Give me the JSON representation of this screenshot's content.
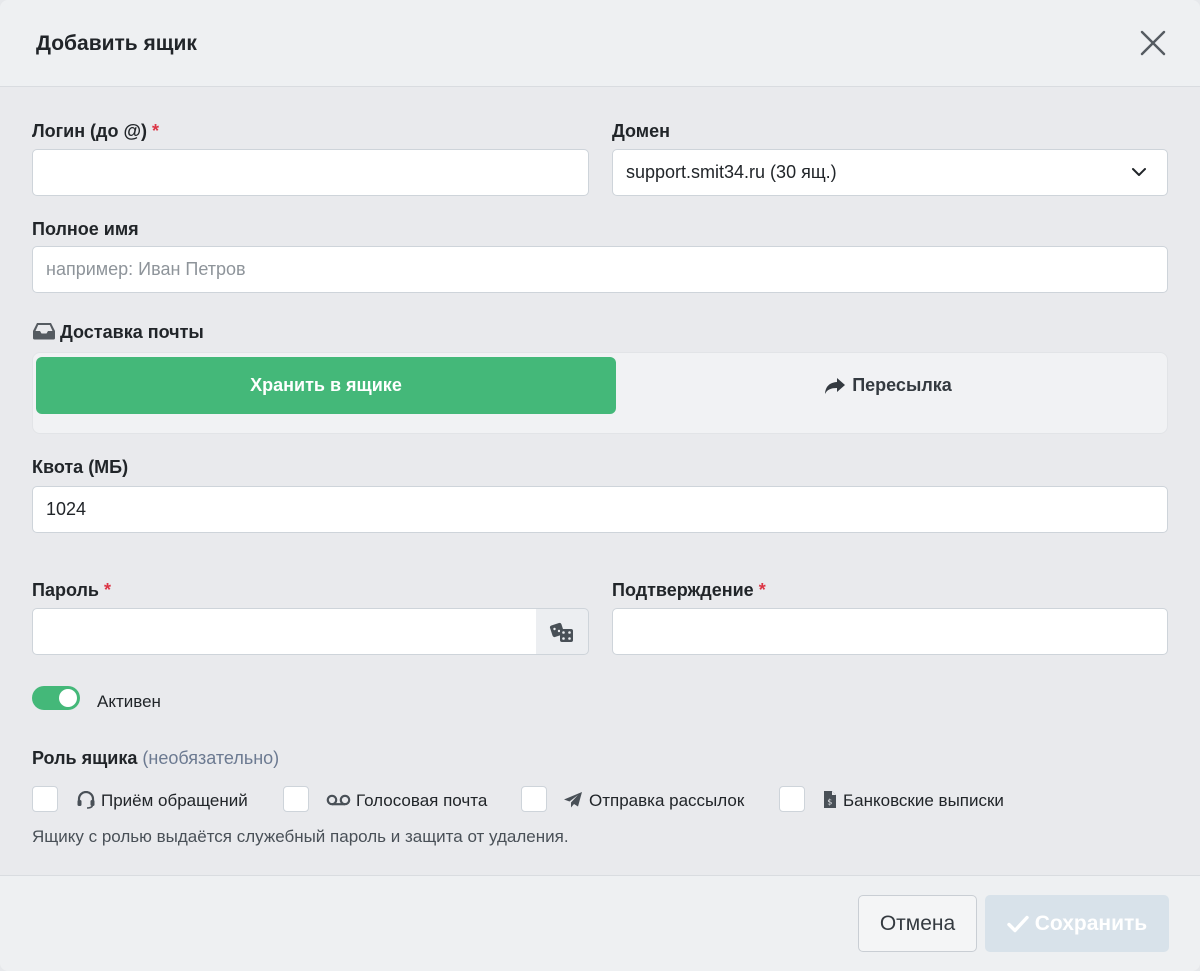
{
  "modal": {
    "title": "Добавить ящик"
  },
  "form": {
    "login": {
      "label": "Логин (до @)",
      "required_mark": "*",
      "value": ""
    },
    "domain": {
      "label": "Домен",
      "selected": "support.smit34.ru (30 ящ.)"
    },
    "full_name": {
      "label": "Полное имя",
      "placeholder": "например: Иван Петров",
      "value": ""
    },
    "delivery": {
      "label": "Доставка почты",
      "options": [
        {
          "label": "Хранить в ящике",
          "active": true
        },
        {
          "label": "Пересылка",
          "active": false
        }
      ]
    },
    "quota": {
      "label": "Квота (МБ)",
      "value": "1024"
    },
    "password": {
      "label": "Пароль",
      "required_mark": "*",
      "value": ""
    },
    "confirm": {
      "label": "Подтверждение",
      "required_mark": "*",
      "value": ""
    },
    "active": {
      "label": "Активен",
      "on": true
    },
    "role": {
      "label": "Роль ящика",
      "optional": "(необязательно)",
      "options": [
        {
          "label": "Приём обращений",
          "icon": "headset-icon",
          "checked": false
        },
        {
          "label": "Голосовая почта",
          "icon": "voicemail-icon",
          "checked": false
        },
        {
          "label": "Отправка рассылок",
          "icon": "paper-plane-icon",
          "checked": false
        },
        {
          "label": "Банковские выписки",
          "icon": "invoice-icon",
          "checked": false
        }
      ],
      "hint": "Ящику с ролью выдаётся служебный пароль и защита от удаления."
    }
  },
  "footer": {
    "cancel_label": "Отмена",
    "save_label": "Сохранить"
  },
  "colors": {
    "accent": "#44b879",
    "required": "#dc3545",
    "save_disabled": "#d8e2ea"
  }
}
